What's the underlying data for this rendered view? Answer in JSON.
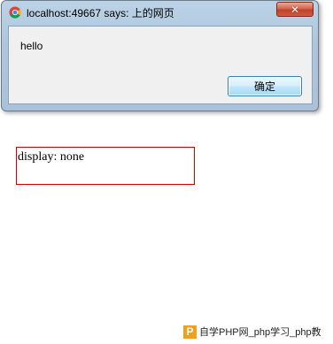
{
  "dialog": {
    "title": "localhost:49667 says: 上的网页",
    "close_label": "✕",
    "message": "hello",
    "ok_label": "确定"
  },
  "page": {
    "box_text": "display: none"
  },
  "watermark": {
    "logo_letter": "P",
    "text": "自学PHP网_php学习_php教"
  },
  "colors": {
    "box_border": "#cc0000",
    "close_button": "#c2402a",
    "dialog_frame": "#aec6dd",
    "watermark_logo": "#f0a020"
  }
}
